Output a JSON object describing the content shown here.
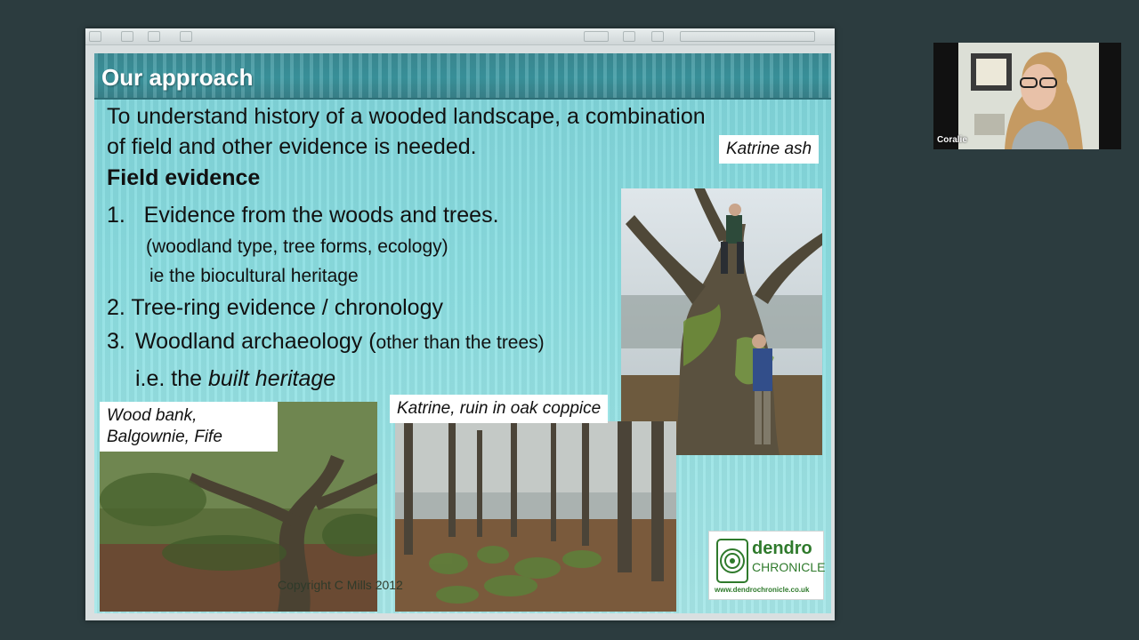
{
  "slide": {
    "title": "Our approach",
    "intro": "To understand history of a wooded landscape, a combination of field and other evidence is needed.",
    "field_evidence_heading": "Field evidence",
    "item1": "1.   Evidence from the woods and trees.",
    "item1_sub1": "(woodland type, tree forms, ecology)",
    "item1_sub2": "ie the biocultural heritage",
    "item2": "2. Tree-ring evidence / chronology",
    "item3_num": "3.",
    "item3": "Woodland archaeology (",
    "item3_small": "other than the trees)",
    "item3_ie_prefix": "i.e. the ",
    "item3_ie_emph": "built heritage",
    "captions": {
      "katrine_ash": "Katrine ash",
      "wood_bank": "Wood bank, Balgownie, Fife",
      "katrine_ruin": "Katrine, ruin in oak coppice"
    },
    "copyright": "Copyright C Mills 2012",
    "logo": {
      "line1": "dendro",
      "line2": "CHRONICLE",
      "url": "www.dendrochronicle.co.uk"
    }
  },
  "participant": {
    "name": "Coralie"
  },
  "colors": {
    "background": "#2c3c3f",
    "title_bar": "#3c9aa3",
    "slide_bg": "#8cdfe2",
    "logo_green": "#2f7a2c"
  }
}
